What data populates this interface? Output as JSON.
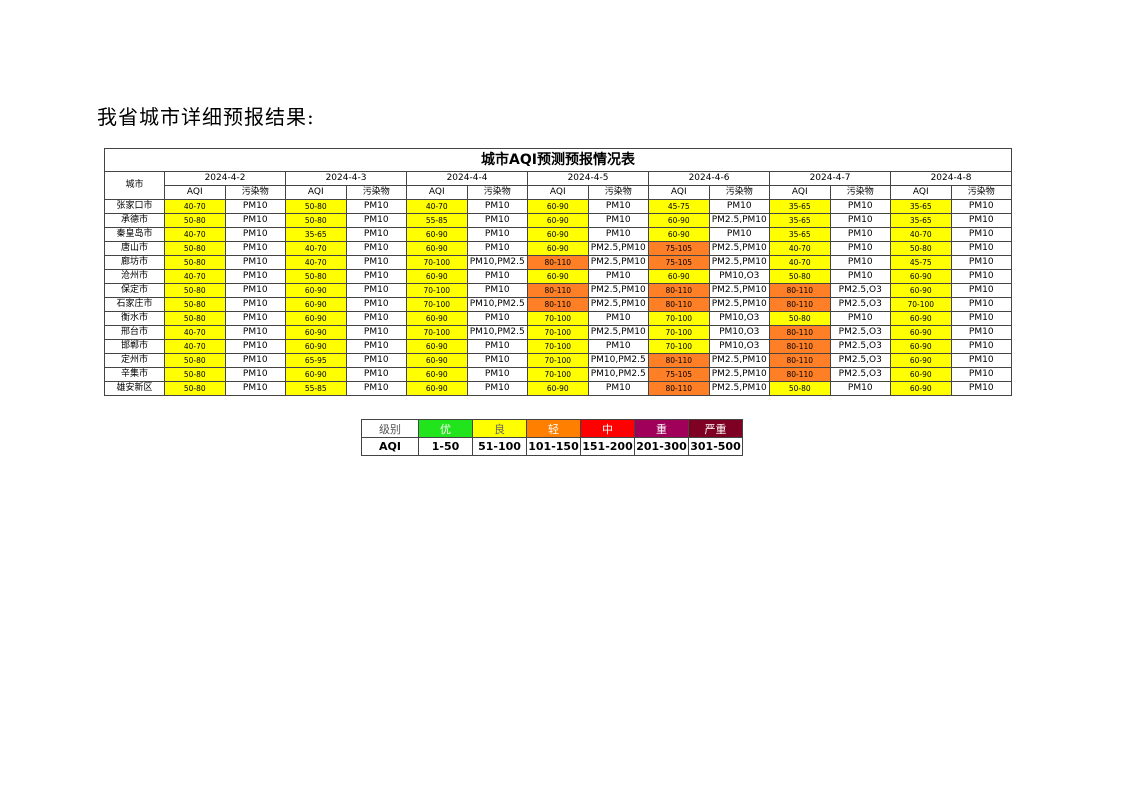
{
  "heading": "我省城市详细预报结果:",
  "table": {
    "title": "城市AQI预测预报情况表",
    "city_header": "城市",
    "aqi_header": "AQI",
    "pollutant_header": "污染物",
    "dates": [
      "2024-4-2",
      "2024-4-3",
      "2024-4-4",
      "2024-4-5",
      "2024-4-6",
      "2024-4-7",
      "2024-4-8"
    ],
    "rows": [
      {
        "city": "张家口市",
        "cells": [
          [
            "40-70",
            "PM10"
          ],
          [
            "50-80",
            "PM10"
          ],
          [
            "40-70",
            "PM10"
          ],
          [
            "60-90",
            "PM10"
          ],
          [
            "45-75",
            "PM10"
          ],
          [
            "35-65",
            "PM10"
          ],
          [
            "35-65",
            "PM10"
          ]
        ]
      },
      {
        "city": "承德市",
        "cells": [
          [
            "50-80",
            "PM10"
          ],
          [
            "50-80",
            "PM10"
          ],
          [
            "55-85",
            "PM10"
          ],
          [
            "60-90",
            "PM10"
          ],
          [
            "60-90",
            "PM2.5,PM10"
          ],
          [
            "35-65",
            "PM10"
          ],
          [
            "35-65",
            "PM10"
          ]
        ]
      },
      {
        "city": "秦皇岛市",
        "cells": [
          [
            "40-70",
            "PM10"
          ],
          [
            "35-65",
            "PM10"
          ],
          [
            "60-90",
            "PM10"
          ],
          [
            "60-90",
            "PM10"
          ],
          [
            "60-90",
            "PM10"
          ],
          [
            "35-65",
            "PM10"
          ],
          [
            "40-70",
            "PM10"
          ]
        ]
      },
      {
        "city": "唐山市",
        "cells": [
          [
            "50-80",
            "PM10"
          ],
          [
            "40-70",
            "PM10"
          ],
          [
            "60-90",
            "PM10"
          ],
          [
            "60-90",
            "PM2.5,PM10"
          ],
          [
            "75-105",
            "PM2.5,PM10"
          ],
          [
            "40-70",
            "PM10"
          ],
          [
            "50-80",
            "PM10"
          ]
        ]
      },
      {
        "city": "廊坊市",
        "cells": [
          [
            "50-80",
            "PM10"
          ],
          [
            "40-70",
            "PM10"
          ],
          [
            "70-100",
            "PM10,PM2.5"
          ],
          [
            "80-110",
            "PM2.5,PM10"
          ],
          [
            "75-105",
            "PM2.5,PM10"
          ],
          [
            "40-70",
            "PM10"
          ],
          [
            "45-75",
            "PM10"
          ]
        ]
      },
      {
        "city": "沧州市",
        "cells": [
          [
            "40-70",
            "PM10"
          ],
          [
            "50-80",
            "PM10"
          ],
          [
            "60-90",
            "PM10"
          ],
          [
            "60-90",
            "PM10"
          ],
          [
            "60-90",
            "PM10,O3"
          ],
          [
            "50-80",
            "PM10"
          ],
          [
            "60-90",
            "PM10"
          ]
        ]
      },
      {
        "city": "保定市",
        "cells": [
          [
            "50-80",
            "PM10"
          ],
          [
            "60-90",
            "PM10"
          ],
          [
            "70-100",
            "PM10"
          ],
          [
            "80-110",
            "PM2.5,PM10"
          ],
          [
            "80-110",
            "PM2.5,PM10"
          ],
          [
            "80-110",
            "PM2.5,O3"
          ],
          [
            "60-90",
            "PM10"
          ]
        ]
      },
      {
        "city": "石家庄市",
        "cells": [
          [
            "50-80",
            "PM10"
          ],
          [
            "60-90",
            "PM10"
          ],
          [
            "70-100",
            "PM10,PM2.5"
          ],
          [
            "80-110",
            "PM2.5,PM10"
          ],
          [
            "80-110",
            "PM2.5,PM10"
          ],
          [
            "80-110",
            "PM2.5,O3"
          ],
          [
            "70-100",
            "PM10"
          ]
        ]
      },
      {
        "city": "衡水市",
        "cells": [
          [
            "50-80",
            "PM10"
          ],
          [
            "60-90",
            "PM10"
          ],
          [
            "60-90",
            "PM10"
          ],
          [
            "70-100",
            "PM10"
          ],
          [
            "70-100",
            "PM10,O3"
          ],
          [
            "50-80",
            "PM10"
          ],
          [
            "60-90",
            "PM10"
          ]
        ]
      },
      {
        "city": "邢台市",
        "cells": [
          [
            "40-70",
            "PM10"
          ],
          [
            "60-90",
            "PM10"
          ],
          [
            "70-100",
            "PM10,PM2.5"
          ],
          [
            "70-100",
            "PM2.5,PM10"
          ],
          [
            "70-100",
            "PM10,O3"
          ],
          [
            "80-110",
            "PM2.5,O3"
          ],
          [
            "60-90",
            "PM10"
          ]
        ]
      },
      {
        "city": "邯郸市",
        "cells": [
          [
            "40-70",
            "PM10"
          ],
          [
            "60-90",
            "PM10"
          ],
          [
            "60-90",
            "PM10"
          ],
          [
            "70-100",
            "PM10"
          ],
          [
            "70-100",
            "PM10,O3"
          ],
          [
            "80-110",
            "PM2.5,O3"
          ],
          [
            "60-90",
            "PM10"
          ]
        ]
      },
      {
        "city": "定州市",
        "cells": [
          [
            "50-80",
            "PM10"
          ],
          [
            "65-95",
            "PM10"
          ],
          [
            "60-90",
            "PM10"
          ],
          [
            "70-100",
            "PM10,PM2.5"
          ],
          [
            "80-110",
            "PM2.5,PM10"
          ],
          [
            "80-110",
            "PM2.5,O3"
          ],
          [
            "60-90",
            "PM10"
          ]
        ]
      },
      {
        "city": "辛集市",
        "cells": [
          [
            "50-80",
            "PM10"
          ],
          [
            "60-90",
            "PM10"
          ],
          [
            "60-90",
            "PM10"
          ],
          [
            "70-100",
            "PM10,PM2.5"
          ],
          [
            "75-105",
            "PM2.5,PM10"
          ],
          [
            "80-110",
            "PM2.5,O3"
          ],
          [
            "60-90",
            "PM10"
          ]
        ]
      },
      {
        "city": "雄安新区",
        "cells": [
          [
            "50-80",
            "PM10"
          ],
          [
            "55-85",
            "PM10"
          ],
          [
            "60-90",
            "PM10"
          ],
          [
            "60-90",
            "PM10"
          ],
          [
            "80-110",
            "PM2.5,PM10"
          ],
          [
            "50-80",
            "PM10"
          ],
          [
            "60-90",
            "PM10"
          ]
        ]
      }
    ]
  },
  "colors": {
    "good": "#ffff00",
    "light": "#ff7f27",
    "excellent": "#00e400",
    "moderate": "#ff0000",
    "heavy": "#99004c",
    "severe": "#7e0023"
  },
  "legend": {
    "level_label": "级别",
    "aqi_label": "AQI",
    "levels": [
      {
        "name": "优",
        "range": "1-50",
        "color": "#22e41c",
        "text_color": "#ffffff"
      },
      {
        "name": "良",
        "range": "51-100",
        "color": "#ffff00",
        "text_color": "#666666"
      },
      {
        "name": "轻",
        "range": "101-150",
        "color": "#ff7f00",
        "text_color": "#ffffff"
      },
      {
        "name": "中",
        "range": "151-200",
        "color": "#ff0000",
        "text_color": "#ffffff"
      },
      {
        "name": "重",
        "range": "201-300",
        "color": "#a0005a",
        "text_color": "#ffffff"
      },
      {
        "name": "严重",
        "range": "301-500",
        "color": "#7e0023",
        "text_color": "#ffffff"
      }
    ]
  }
}
